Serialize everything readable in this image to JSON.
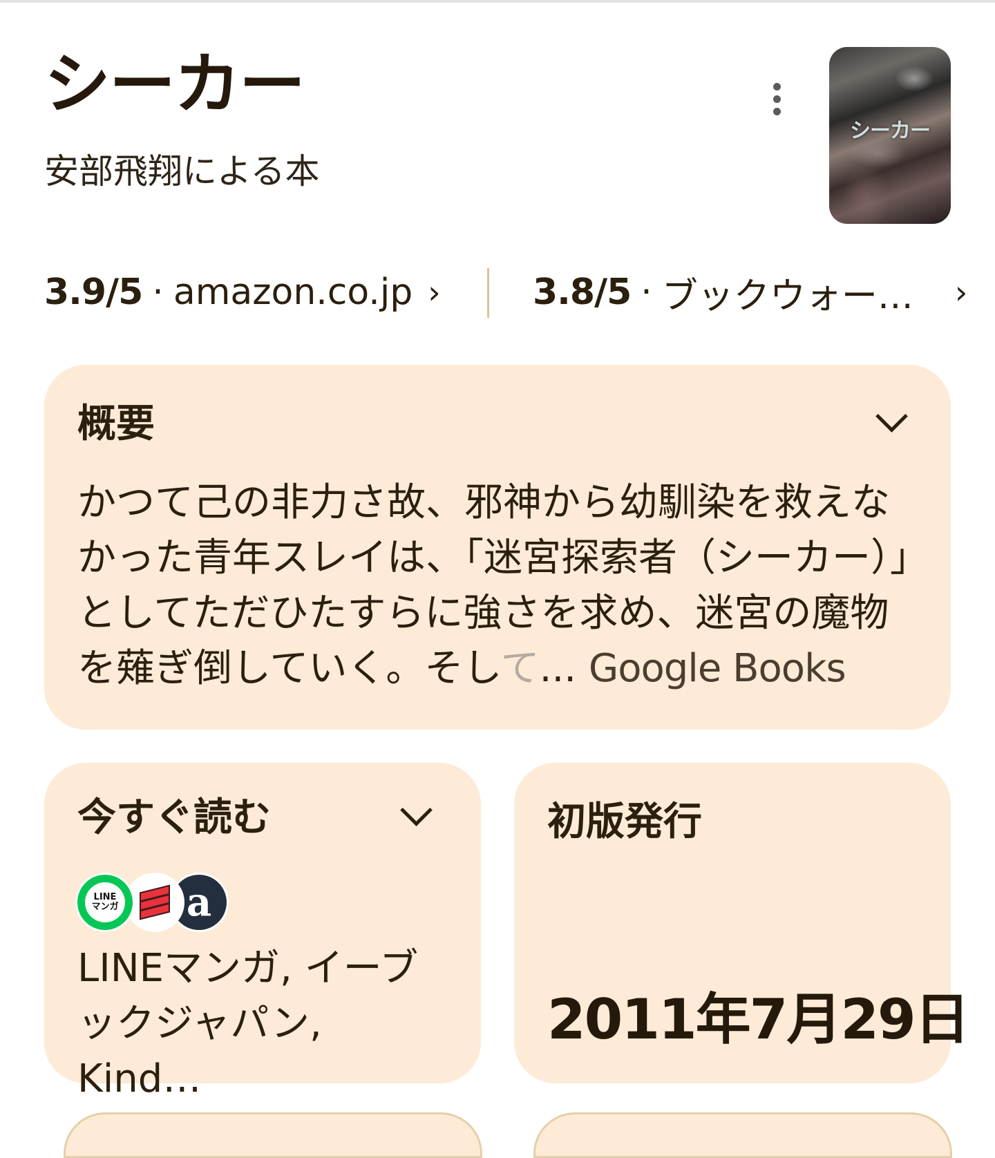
{
  "book": {
    "title": "シーカー",
    "subtitle": "安部飛翔による本",
    "cover_text": "シーカー"
  },
  "ratings": [
    {
      "score": "3.9/5",
      "source": "amazon.co.jp"
    },
    {
      "score": "3.8/5",
      "source": "ブックウォー…"
    }
  ],
  "summary": {
    "title": "概要",
    "text_main": "かつて己の非力さ故、邪神から幼馴染を救えなかった青年スレイは、「迷宮探索者（シーカー）」としてただひたすらに強さを求め、迷宮の魔物を薙ぎ倒していく。そし",
    "text_fade": "て",
    "ellipsis": "... ",
    "source": "Google Books"
  },
  "read_now": {
    "title": "今すぐ読む",
    "logos": [
      "LINEマンガ",
      "eBookJapan",
      "Amazon Kindle"
    ],
    "line_logo_text": [
      "LINE",
      "マンガ"
    ],
    "amazon_logo_text": "a",
    "text": "LINEマンガ, イーブックジャパン, Kind…"
  },
  "first_published": {
    "title": "初版発行",
    "date": "2011年7月29日"
  }
}
